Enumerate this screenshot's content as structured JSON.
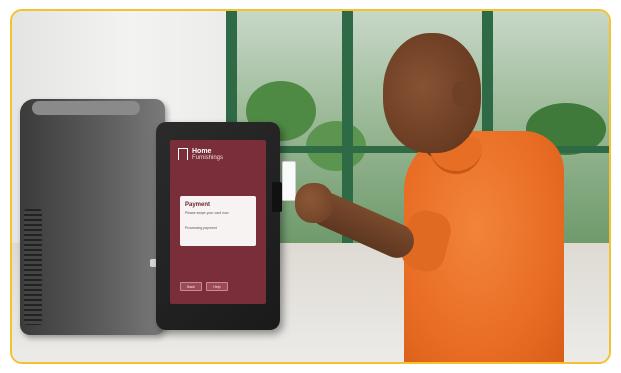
{
  "kiosk": {
    "brand_home": "Home",
    "brand_furnishings": "Furnishings",
    "panel_title": "Payment",
    "panel_line1": "Please swipe your card now",
    "panel_line2": "Processing payment",
    "button_left": "Back",
    "button_right": "Help"
  },
  "colors": {
    "frame_border": "#f2c230",
    "screen": "#7a2e3a",
    "shirt": "#e96d24"
  }
}
